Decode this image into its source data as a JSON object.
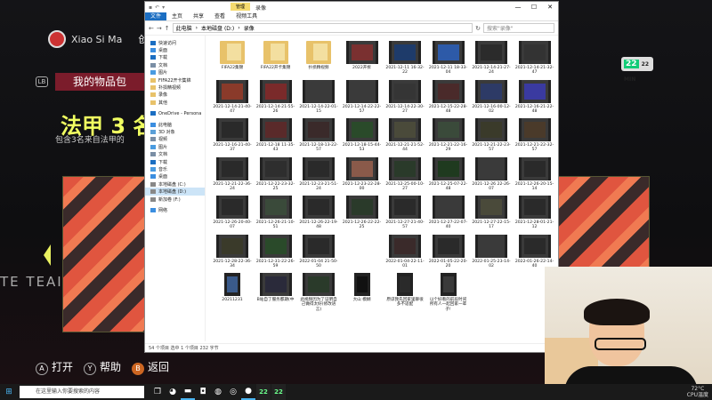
{
  "game": {
    "username": "Xiao Si Ma",
    "create_text": "创建于",
    "lb": "LB",
    "item_bag": "我的物品包",
    "pack_title": "法甲 3 名",
    "pack_desc": "包含3名来自法甲的",
    "team_text": "TE TEAI",
    "footer": {
      "open": "打开",
      "help": "帮助",
      "back": "返回",
      "open_btn": "A",
      "help_btn": "Y",
      "back_btn": "B"
    },
    "badge": {
      "num": "22",
      "text": "22 MIN"
    }
  },
  "explorer": {
    "title": "",
    "manage_tab": "管理",
    "title_text": "录像",
    "qa_icons": [
      "save-icon",
      "undo-icon",
      "dropdown-icon"
    ],
    "window_controls": [
      "—",
      "☐",
      "✕"
    ],
    "ribbon": [
      "文件",
      "主页",
      "共享",
      "查看",
      "视频工具"
    ],
    "address": {
      "path": [
        "此电脑",
        "本地磁盘 (D:)",
        "录像"
      ],
      "search_placeholder": "搜索\"录像\""
    },
    "nav": [
      {
        "label": "快速访问",
        "icon": "star-icon",
        "color": "#1b6ec2",
        "sel": false
      },
      {
        "label": "桌面",
        "icon": "desktop-icon",
        "color": "#3b8ee0",
        "sel": false
      },
      {
        "label": "下载",
        "icon": "download-icon",
        "color": "#1b6ec2",
        "sel": false
      },
      {
        "label": "文档",
        "icon": "document-icon",
        "color": "#7a8ea5",
        "sel": false
      },
      {
        "label": "图片",
        "icon": "picture-icon",
        "color": "#4a9be0",
        "sel": false
      },
      {
        "label": "FIFA22开卡集锦",
        "icon": "folder-icon",
        "color": "#e8c26a",
        "sel": false
      },
      {
        "label": "扑损精视频",
        "icon": "folder-icon",
        "color": "#e8c26a",
        "sel": false
      },
      {
        "label": "录像",
        "icon": "folder-icon",
        "color": "#e8c26a",
        "sel": false
      },
      {
        "label": "其他",
        "icon": "folder-icon",
        "color": "#e8c26a",
        "sel": false
      },
      {
        "label": "",
        "sp": true
      },
      {
        "label": "OneDrive - Persona",
        "icon": "cloud-icon",
        "color": "#1b6ec2",
        "sel": false
      },
      {
        "label": "",
        "sp": true
      },
      {
        "label": "此电脑",
        "icon": "computer-icon",
        "color": "#3b8ee0",
        "sel": false
      },
      {
        "label": "3D 对象",
        "icon": "cube-icon",
        "color": "#5ba0d8",
        "sel": false
      },
      {
        "label": "视频",
        "icon": "video-icon",
        "color": "#7a8ea5",
        "sel": false
      },
      {
        "label": "图片",
        "icon": "picture-icon",
        "color": "#4a9be0",
        "sel": false
      },
      {
        "label": "文档",
        "icon": "document-icon",
        "color": "#7a8ea5",
        "sel": false
      },
      {
        "label": "下载",
        "icon": "download-icon",
        "color": "#1b6ec2",
        "sel": false
      },
      {
        "label": "音乐",
        "icon": "music-icon",
        "color": "#4a9be0",
        "sel": false
      },
      {
        "label": "桌面",
        "icon": "desktop-icon",
        "color": "#3b8ee0",
        "sel": false
      },
      {
        "label": "本地磁盘 (C:)",
        "icon": "drive-icon",
        "color": "#888888",
        "sel": false
      },
      {
        "label": "本地磁盘 (D:)",
        "icon": "drive-icon",
        "color": "#888888",
        "sel": true
      },
      {
        "label": "新加卷 (F:)",
        "icon": "drive-icon",
        "color": "#888888",
        "sel": false
      },
      {
        "label": "",
        "sp": true
      },
      {
        "label": "网络",
        "icon": "network-icon",
        "color": "#3b8ee0",
        "sel": false
      }
    ],
    "rows": [
      [
        {
          "label": "FIFA22集锦",
          "kind": "folder"
        },
        {
          "label": "FIFA22开卡集锦",
          "kind": "folder"
        },
        {
          "label": "扑损精视频",
          "kind": "folder"
        },
        {
          "label": "2022开拆",
          "kind": "video",
          "c": "#7a3030"
        },
        {
          "label": "2021-12-11 16-32-22",
          "kind": "video",
          "c": "#1e3b6a"
        },
        {
          "label": "2021-12-11 18-33-04",
          "kind": "video",
          "c": "#2d5aa8"
        },
        {
          "label": "2021-12-14-21-27-24",
          "kind": "video",
          "c": "#2b2b2b"
        },
        {
          "label": "2021-12-14-21-32-47",
          "kind": "video",
          "c": "#333333"
        }
      ],
      [
        {
          "label": "2021-12-14-21-40-47",
          "kind": "video",
          "c": "#8a3a2a"
        },
        {
          "label": "2021-12-14-21-55-26",
          "kind": "video",
          "c": "#7a2a2a"
        },
        {
          "label": "2021-12-14-22-01-15",
          "kind": "video",
          "c": "#3a3a3a"
        },
        {
          "label": "2021-12-14-22-22-57",
          "kind": "video",
          "c": "#3a3a3a"
        },
        {
          "label": "2021-12-14-22-30-27",
          "kind": "video",
          "c": "#353535"
        },
        {
          "label": "2021-12-15-22-28-48",
          "kind": "video",
          "c": "#4a2a2a"
        },
        {
          "label": "2021-12-16-00-12-02",
          "kind": "video",
          "c": "#2d3a66"
        },
        {
          "label": "2021-12-16-21-22-48",
          "kind": "video",
          "c": "#3a3aa0"
        }
      ],
      [
        {
          "label": "2021-12-16-21-40-37",
          "kind": "video",
          "c": "#2a2a2a"
        },
        {
          "label": "2021-12-18 11-35-43",
          "kind": "video",
          "c": "#5a2a2a"
        },
        {
          "label": "2021-12-18-13-22-57",
          "kind": "video",
          "c": "#3a2a2a"
        },
        {
          "label": "2021-12-18-15-44-53",
          "kind": "video",
          "c": "#2a4a2a"
        },
        {
          "label": "2021-12-21-21-52-44",
          "kind": "video",
          "c": "#4a4a3a"
        },
        {
          "label": "2021-12-21-22-16-29",
          "kind": "video",
          "c": "#3a4a3a"
        },
        {
          "label": "2021-12-21-22-23-57",
          "kind": "video",
          "c": "#3a3a2a"
        },
        {
          "label": "2021-12-21-22-32-57",
          "kind": "video",
          "c": "#4a3a2a"
        }
      ],
      [
        {
          "label": "2021-12-21-22-36-24",
          "kind": "video",
          "c": "#2a2a2a"
        },
        {
          "label": "2021-12-22-23-32-25",
          "kind": "video",
          "c": "#2e2e2e"
        },
        {
          "label": "2021-12-23-21-51-24",
          "kind": "video",
          "c": "#2a2a2a"
        },
        {
          "label": "2021-12-23-22-28-00",
          "kind": "video",
          "c": "#8a5a4a"
        },
        {
          "label": "2021-12-25-00-10-27",
          "kind": "video",
          "c": "#2a3a2a"
        },
        {
          "label": "2021-12-25-07-22-48",
          "kind": "video",
          "c": "#1f3a1f"
        },
        {
          "label": "2021-12-26 22-26-07",
          "kind": "video",
          "c": "#3a3a3a"
        },
        {
          "label": "2021-12-26-20-15-14",
          "kind": "video",
          "c": "#2a2a2a"
        }
      ],
      [
        {
          "label": "2021-12-26-20-40-07",
          "kind": "video",
          "c": "#2a2a2a"
        },
        {
          "label": "2021-12-26-21-10-51",
          "kind": "video",
          "c": "#3a4a3a"
        },
        {
          "label": "2021-12-26-22-19-48",
          "kind": "video",
          "c": "#2a2a2a"
        },
        {
          "label": "2021-12-26-22-22-25",
          "kind": "video",
          "c": "#2a3a2a"
        },
        {
          "label": "2021-12-27-21-40-57",
          "kind": "video",
          "c": "#2a2a2a"
        },
        {
          "label": "2021-12-27-22-07-40",
          "kind": "video",
          "c": "#3a3a3a"
        },
        {
          "label": "2021-12-27-22-15-17",
          "kind": "video",
          "c": "#4a4a3a"
        },
        {
          "label": "2021-12-28-01-21-12",
          "kind": "video",
          "c": "#2a2a2a"
        }
      ],
      [
        {
          "label": "2021-12-28-22-36-34",
          "kind": "video",
          "c": "#3a3a2a"
        },
        {
          "label": "2021-12-31-22-26-59",
          "kind": "video",
          "c": "#2a4a2a"
        },
        {
          "label": "2022-01-04 21-50-50",
          "kind": "video",
          "c": "#2a2a2a"
        },
        {
          "label": "",
          "kind": "none"
        },
        {
          "label": "2022-01-04-22-11-01",
          "kind": "video",
          "c": "#3a2a2a"
        },
        {
          "label": "2022-01-05-22-20-20",
          "kind": "video",
          "c": "#2a2a2a"
        },
        {
          "label": "2022-01-25-23-14-02",
          "kind": "video",
          "c": "#3a3a3a"
        },
        {
          "label": "2022-01-26-22-14-40",
          "kind": "video",
          "c": "#2a2a2a"
        },
        {
          "label": "2022-0 22-36",
          "kind": "media",
          "c": "#1b6ec2"
        }
      ],
      [
        {
          "label": "20211231",
          "kind": "portrait",
          "c": "#3a5a8a"
        },
        {
          "label": "B站自了服务都期(中",
          "kind": "video",
          "c": "#2a2a3a"
        },
        {
          "label": "此视频因为了证明自己做得太好(修改语言)",
          "kind": "video",
          "c": "#2a3a2a"
        },
        {
          "label": "大山 模糊",
          "kind": "portrait",
          "c": "#111111"
        },
        {
          "label": "原谅我先回家里聊很多不适配",
          "kind": "portrait",
          "c": "#2a2a2a"
        },
        {
          "label": "以个好看的前段时间所有人一起回家一辈子!",
          "kind": "portrait",
          "c": "#3a3a3a"
        }
      ]
    ],
    "status": "54 个项目 选中 1 个项目 232 字节"
  },
  "taskbar": {
    "search_placeholder": "在这里输入你要搜索的内容",
    "temp": "72°C",
    "cpu": "CPU温度",
    "apps": [
      {
        "name": "task-view-icon",
        "g": "❐",
        "a": false
      },
      {
        "name": "edge-icon",
        "g": "◕",
        "a": false
      },
      {
        "name": "file-explorer-icon",
        "g": "▬",
        "a": true
      },
      {
        "name": "store-icon",
        "g": "◘",
        "a": false
      },
      {
        "name": "chrome-icon",
        "g": "◍",
        "a": false
      },
      {
        "name": "wechat-icon",
        "g": "◎",
        "a": false
      },
      {
        "name": "obs-icon",
        "g": "●",
        "a": true
      },
      {
        "name": "fifa22-icon",
        "g": "22",
        "a": false,
        "fifa": true
      },
      {
        "name": "fifa22-icon",
        "g": "22",
        "a": false,
        "fifa": true
      }
    ]
  }
}
